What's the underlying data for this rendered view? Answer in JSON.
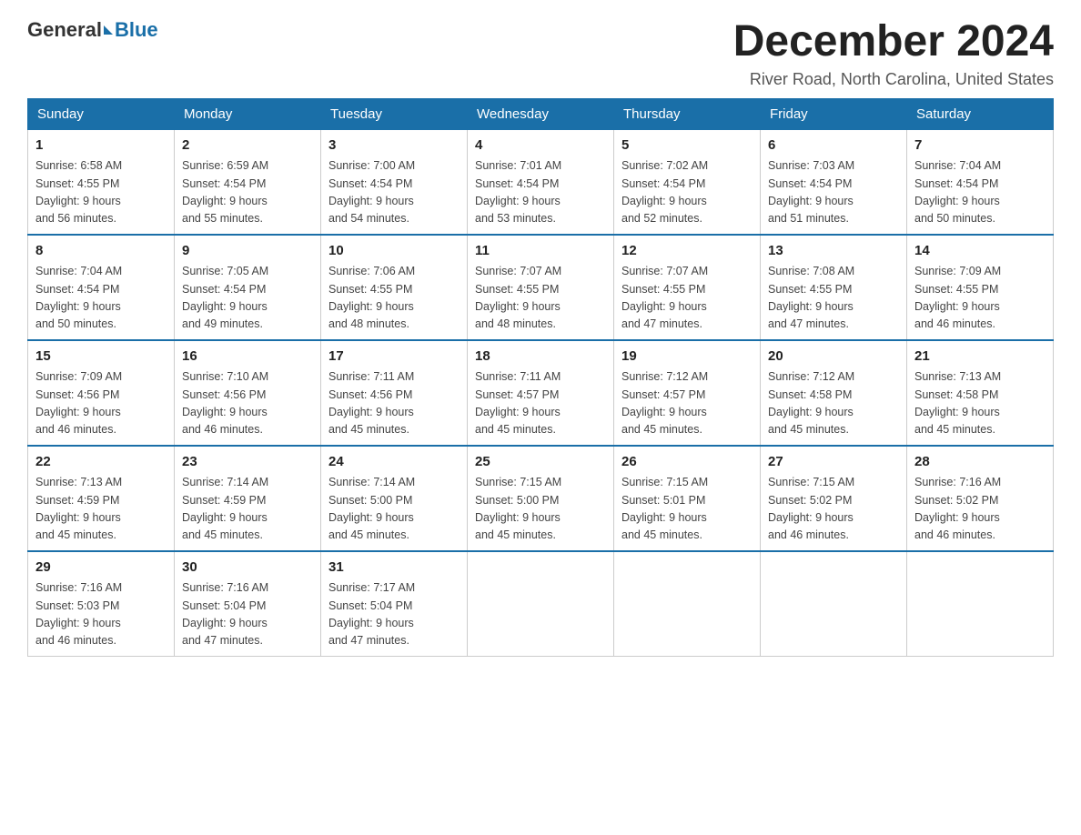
{
  "logo": {
    "general": "General",
    "blue": "Blue"
  },
  "title": "December 2024",
  "location": "River Road, North Carolina, United States",
  "headers": [
    "Sunday",
    "Monday",
    "Tuesday",
    "Wednesday",
    "Thursday",
    "Friday",
    "Saturday"
  ],
  "weeks": [
    [
      {
        "day": "1",
        "sunrise": "6:58 AM",
        "sunset": "4:55 PM",
        "daylight": "9 hours and 56 minutes."
      },
      {
        "day": "2",
        "sunrise": "6:59 AM",
        "sunset": "4:54 PM",
        "daylight": "9 hours and 55 minutes."
      },
      {
        "day": "3",
        "sunrise": "7:00 AM",
        "sunset": "4:54 PM",
        "daylight": "9 hours and 54 minutes."
      },
      {
        "day": "4",
        "sunrise": "7:01 AM",
        "sunset": "4:54 PM",
        "daylight": "9 hours and 53 minutes."
      },
      {
        "day": "5",
        "sunrise": "7:02 AM",
        "sunset": "4:54 PM",
        "daylight": "9 hours and 52 minutes."
      },
      {
        "day": "6",
        "sunrise": "7:03 AM",
        "sunset": "4:54 PM",
        "daylight": "9 hours and 51 minutes."
      },
      {
        "day": "7",
        "sunrise": "7:04 AM",
        "sunset": "4:54 PM",
        "daylight": "9 hours and 50 minutes."
      }
    ],
    [
      {
        "day": "8",
        "sunrise": "7:04 AM",
        "sunset": "4:54 PM",
        "daylight": "9 hours and 50 minutes."
      },
      {
        "day": "9",
        "sunrise": "7:05 AM",
        "sunset": "4:54 PM",
        "daylight": "9 hours and 49 minutes."
      },
      {
        "day": "10",
        "sunrise": "7:06 AM",
        "sunset": "4:55 PM",
        "daylight": "9 hours and 48 minutes."
      },
      {
        "day": "11",
        "sunrise": "7:07 AM",
        "sunset": "4:55 PM",
        "daylight": "9 hours and 48 minutes."
      },
      {
        "day": "12",
        "sunrise": "7:07 AM",
        "sunset": "4:55 PM",
        "daylight": "9 hours and 47 minutes."
      },
      {
        "day": "13",
        "sunrise": "7:08 AM",
        "sunset": "4:55 PM",
        "daylight": "9 hours and 47 minutes."
      },
      {
        "day": "14",
        "sunrise": "7:09 AM",
        "sunset": "4:55 PM",
        "daylight": "9 hours and 46 minutes."
      }
    ],
    [
      {
        "day": "15",
        "sunrise": "7:09 AM",
        "sunset": "4:56 PM",
        "daylight": "9 hours and 46 minutes."
      },
      {
        "day": "16",
        "sunrise": "7:10 AM",
        "sunset": "4:56 PM",
        "daylight": "9 hours and 46 minutes."
      },
      {
        "day": "17",
        "sunrise": "7:11 AM",
        "sunset": "4:56 PM",
        "daylight": "9 hours and 45 minutes."
      },
      {
        "day": "18",
        "sunrise": "7:11 AM",
        "sunset": "4:57 PM",
        "daylight": "9 hours and 45 minutes."
      },
      {
        "day": "19",
        "sunrise": "7:12 AM",
        "sunset": "4:57 PM",
        "daylight": "9 hours and 45 minutes."
      },
      {
        "day": "20",
        "sunrise": "7:12 AM",
        "sunset": "4:58 PM",
        "daylight": "9 hours and 45 minutes."
      },
      {
        "day": "21",
        "sunrise": "7:13 AM",
        "sunset": "4:58 PM",
        "daylight": "9 hours and 45 minutes."
      }
    ],
    [
      {
        "day": "22",
        "sunrise": "7:13 AM",
        "sunset": "4:59 PM",
        "daylight": "9 hours and 45 minutes."
      },
      {
        "day": "23",
        "sunrise": "7:14 AM",
        "sunset": "4:59 PM",
        "daylight": "9 hours and 45 minutes."
      },
      {
        "day": "24",
        "sunrise": "7:14 AM",
        "sunset": "5:00 PM",
        "daylight": "9 hours and 45 minutes."
      },
      {
        "day": "25",
        "sunrise": "7:15 AM",
        "sunset": "5:00 PM",
        "daylight": "9 hours and 45 minutes."
      },
      {
        "day": "26",
        "sunrise": "7:15 AM",
        "sunset": "5:01 PM",
        "daylight": "9 hours and 45 minutes."
      },
      {
        "day": "27",
        "sunrise": "7:15 AM",
        "sunset": "5:02 PM",
        "daylight": "9 hours and 46 minutes."
      },
      {
        "day": "28",
        "sunrise": "7:16 AM",
        "sunset": "5:02 PM",
        "daylight": "9 hours and 46 minutes."
      }
    ],
    [
      {
        "day": "29",
        "sunrise": "7:16 AM",
        "sunset": "5:03 PM",
        "daylight": "9 hours and 46 minutes."
      },
      {
        "day": "30",
        "sunrise": "7:16 AM",
        "sunset": "5:04 PM",
        "daylight": "9 hours and 47 minutes."
      },
      {
        "day": "31",
        "sunrise": "7:17 AM",
        "sunset": "5:04 PM",
        "daylight": "9 hours and 47 minutes."
      },
      null,
      null,
      null,
      null
    ]
  ],
  "labels": {
    "sunrise": "Sunrise:",
    "sunset": "Sunset:",
    "daylight": "Daylight:"
  }
}
